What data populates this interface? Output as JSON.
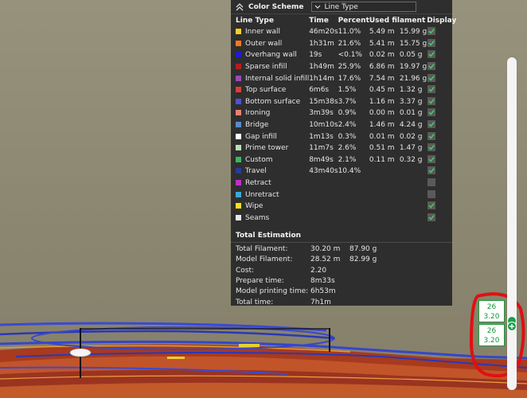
{
  "header": {
    "title": "Color Scheme",
    "scheme_value": "Line Type"
  },
  "table": {
    "columns": [
      "Line Type",
      "Time",
      "Percent",
      "Used filament",
      "Display"
    ],
    "rows": [
      {
        "name": "Inner wall",
        "color": "#f5d020",
        "time": "46m20s",
        "percent": "11.0%",
        "len": "5.49 m",
        "weight": "15.99 g",
        "display": true
      },
      {
        "name": "Outer wall",
        "color": "#f07a20",
        "time": "1h31m",
        "percent": "21.6%",
        "len": "5.41 m",
        "weight": "15.75 g",
        "display": true
      },
      {
        "name": "Overhang wall",
        "color": "#1e1ec8",
        "time": "19s",
        "percent": "<0.1%",
        "len": "0.02 m",
        "weight": "0.05 g",
        "display": true
      },
      {
        "name": "Sparse infill",
        "color": "#b02020",
        "time": "1h49m",
        "percent": "25.9%",
        "len": "6.86 m",
        "weight": "19.97 g",
        "display": true
      },
      {
        "name": "Internal solid infill",
        "color": "#9a4ab8",
        "time": "1h14m",
        "percent": "17.6%",
        "len": "7.54 m",
        "weight": "21.96 g",
        "display": true
      },
      {
        "name": "Top surface",
        "color": "#e03a3a",
        "time": "6m6s",
        "percent": "1.5%",
        "len": "0.45 m",
        "weight": "1.32 g",
        "display": true
      },
      {
        "name": "Bottom surface",
        "color": "#5050d8",
        "time": "15m38s",
        "percent": "3.7%",
        "len": "1.16 m",
        "weight": "3.37 g",
        "display": true
      },
      {
        "name": "Ironing",
        "color": "#f08070",
        "time": "3m39s",
        "percent": "0.9%",
        "len": "0.00 m",
        "weight": "0.01 g",
        "display": true
      },
      {
        "name": "Bridge",
        "color": "#5a8ac8",
        "time": "10m10s",
        "percent": "2.4%",
        "len": "1.46 m",
        "weight": "4.24 g",
        "display": true
      },
      {
        "name": "Gap infill",
        "color": "#ffffff",
        "time": "1m13s",
        "percent": "0.3%",
        "len": "0.01 m",
        "weight": "0.02 g",
        "display": true
      },
      {
        "name": "Prime tower",
        "color": "#b8e0b8",
        "time": "11m7s",
        "percent": "2.6%",
        "len": "0.51 m",
        "weight": "1.47 g",
        "display": true
      },
      {
        "name": "Custom",
        "color": "#3ab860",
        "time": "8m49s",
        "percent": "2.1%",
        "len": "0.11 m",
        "weight": "0.32 g",
        "display": true
      },
      {
        "name": "Travel",
        "color": "#2a3a9a",
        "time": "43m40s",
        "percent": "10.4%",
        "len": "",
        "weight": "",
        "display": true
      },
      {
        "name": "Retract",
        "color": "#c030c8",
        "time": "",
        "percent": "",
        "len": "",
        "weight": "",
        "display": false
      },
      {
        "name": "Unretract",
        "color": "#3aa8d8",
        "time": "",
        "percent": "",
        "len": "",
        "weight": "",
        "display": false
      },
      {
        "name": "Wipe",
        "color": "#f5e020",
        "time": "",
        "percent": "",
        "len": "",
        "weight": "",
        "display": true
      },
      {
        "name": "Seams",
        "color": "#e8e8e8",
        "time": "",
        "percent": "",
        "len": "",
        "weight": "",
        "display": true
      }
    ]
  },
  "estimation": {
    "title": "Total Estimation",
    "rows": [
      {
        "label": "Total Filament:",
        "v1": "30.20 m",
        "v2": "87.90 g"
      },
      {
        "label": "Model Filament:",
        "v1": "28.52 m",
        "v2": "82.99 g"
      },
      {
        "label": "Cost:",
        "v1": "2.20",
        "v2": ""
      },
      {
        "label": "Prepare time:",
        "v1": "8m33s",
        "v2": ""
      },
      {
        "label": "Model printing time:",
        "v1": "6h53m",
        "v2": ""
      },
      {
        "label": "Total time:",
        "v1": "7h1m",
        "v2": ""
      }
    ]
  },
  "slider": {
    "upper": {
      "layer": "26",
      "height": "3.20"
    },
    "lower": {
      "layer": "26",
      "height": "3.20"
    }
  }
}
